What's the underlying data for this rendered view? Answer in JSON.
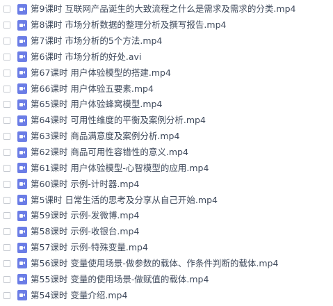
{
  "files": [
    {
      "name": "第9课时 互联网产品诞生的大致流程之什么是需求及需求的分类.mp4",
      "icon": "video-file-icon"
    },
    {
      "name": "第8课时 市场分析数据的整理分析及撰写报告.mp4",
      "icon": "video-file-icon"
    },
    {
      "name": "第7课时 市场分析的5个方法.mp4",
      "icon": "video-file-icon"
    },
    {
      "name": "第6课时 市场分析的好处.avi",
      "icon": "video-file-icon"
    },
    {
      "name": "第67课时 用户体验模型的搭建.mp4",
      "icon": "video-file-icon"
    },
    {
      "name": "第66课时 用户体验五要素.mp4",
      "icon": "video-file-icon"
    },
    {
      "name": "第65课时 用户体验蜂窝模型.mp4",
      "icon": "video-file-icon"
    },
    {
      "name": "第64课时 可用性维度的平衡及案例分析.mp4",
      "icon": "video-file-icon"
    },
    {
      "name": "第63课时 商品满意度及案例分析.mp4",
      "icon": "video-file-icon"
    },
    {
      "name": "第62课时 商品可用性容错性的意义.mp4",
      "icon": "video-file-icon"
    },
    {
      "name": "第61课时 用户体验模型-心智模型的应用.mp4",
      "icon": "video-file-icon"
    },
    {
      "name": "第60课时 示例-计时器.mp4",
      "icon": "video-file-icon"
    },
    {
      "name": "第5课时 日常生活的思考及分享从自己开始.mp4",
      "icon": "video-file-icon"
    },
    {
      "name": "第59课时 示例-发微博.mp4",
      "icon": "video-file-icon"
    },
    {
      "name": "第58课时 示例-收银台.mp4",
      "icon": "video-file-icon"
    },
    {
      "name": "第57课时 示例-特殊变量.mp4",
      "icon": "video-file-icon"
    },
    {
      "name": "第56课时 变量使用场景-做参数的载体、作条件判断的载体.mp4",
      "icon": "video-file-icon"
    },
    {
      "name": "第55课时 变量的使用场景-做赋值的载体.mp4",
      "icon": "video-file-icon"
    },
    {
      "name": "第54课时 变量介绍.mp4",
      "icon": "video-file-icon"
    }
  ]
}
